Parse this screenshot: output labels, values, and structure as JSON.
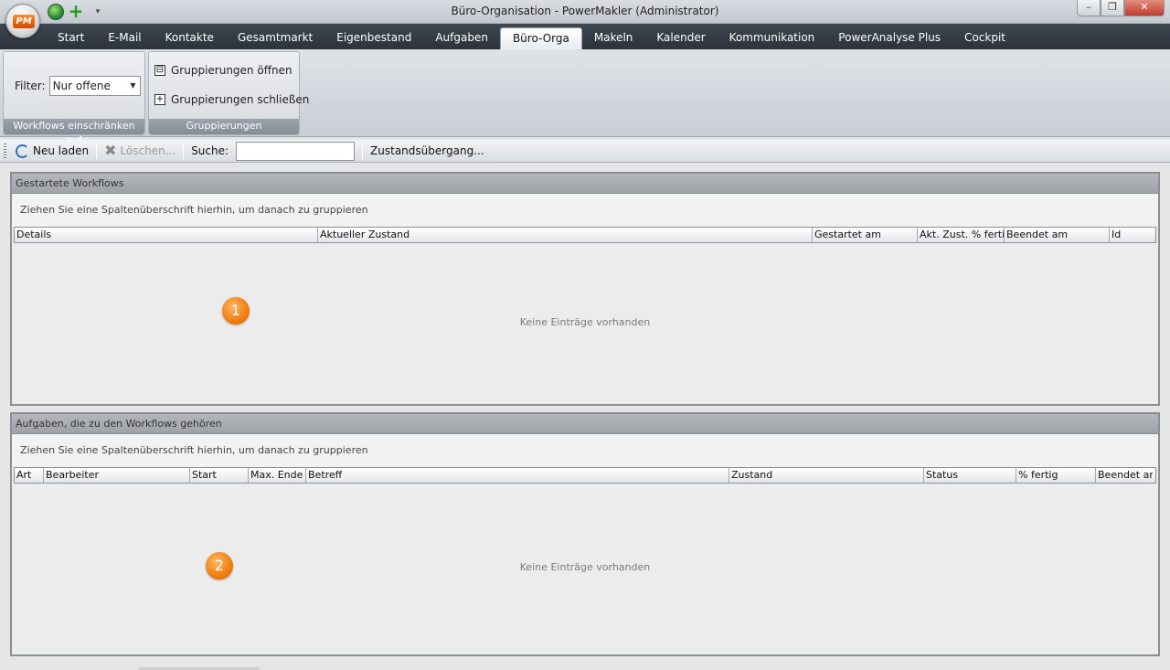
{
  "window": {
    "title": "Büro-Organisation - PowerMakler (Administrator)",
    "logo_text": "PM",
    "minimize": "–",
    "maximize": "❐",
    "close": "✕"
  },
  "tabs": [
    {
      "label": "Start"
    },
    {
      "label": "E-Mail"
    },
    {
      "label": "Kontakte"
    },
    {
      "label": "Gesamtmarkt"
    },
    {
      "label": "Eigenbestand"
    },
    {
      "label": "Aufgaben"
    },
    {
      "label": "Büro-Orga",
      "active": true
    },
    {
      "label": "Makeln"
    },
    {
      "label": "Kalender"
    },
    {
      "label": "Kommunikation"
    },
    {
      "label": "PowerAnalyse Plus"
    },
    {
      "label": "Cockpit"
    }
  ],
  "ribbon": {
    "filter_group": {
      "label": "Workflows einschränken auf",
      "filter_label": "Filter:",
      "filter_value": "Nur offene"
    },
    "grouping_group": {
      "label": "Gruppierungen",
      "open_label": "Gruppierungen öffnen",
      "close_label": "Gruppierungen schließen"
    }
  },
  "toolbar": {
    "reload_label": "Neu laden",
    "delete_label": "Löschen...",
    "search_label": "Suche:",
    "search_value": "",
    "transition_label": "Zustandsübergang..."
  },
  "workflows_panel": {
    "title": "Gestartete Workflows",
    "group_hint": "Ziehen Sie eine Spaltenüberschrift hierhin, um danach zu gruppieren",
    "columns": [
      "Details",
      "Aktueller Zustand",
      "Gestartet am",
      "Akt. Zust. % fertig",
      "Beendet am",
      "Id"
    ],
    "empty_text": "Keine Einträge vorhanden",
    "marker": "1"
  },
  "tasks_panel": {
    "title": "Aufgaben, die zu den Workflows gehören",
    "group_hint": "Ziehen Sie eine Spaltenüberschrift hierhin, um danach zu gruppieren",
    "columns": [
      "Art",
      "Bearbeiter",
      "Start",
      "Max. Ende",
      "Betreff",
      "Zustand",
      "Status",
      "% fertig",
      "Beendet am"
    ],
    "empty_text": "Keine Einträge vorhanden",
    "marker": "2"
  }
}
